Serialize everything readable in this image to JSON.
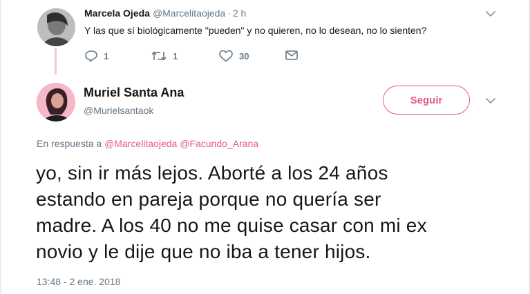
{
  "parent_tweet": {
    "name": "Marcela Ojeda",
    "handle": "@Marcelitaojeda",
    "separator": "·",
    "time": "2 h",
    "text": "Y las que sí biológicamente \"pueden\" y no quieren, no lo desean, no lo sienten?",
    "actions": {
      "reply_count": "1",
      "retweet_count": "1",
      "like_count": "30"
    },
    "icons": [
      "reply-icon",
      "retweet-icon",
      "like-icon",
      "message-icon",
      "chevron-down-icon"
    ]
  },
  "main_tweet": {
    "name": "Muriel Santa Ana",
    "handle": "@Murielsantaok",
    "follow_label": "Seguir",
    "reply_prefix": "En respuesta a",
    "reply_mentions": [
      "@Marcelitaojeda",
      "@Facundo_Arana"
    ],
    "text_lines": [
      "yo, sin ir más lejos. Aborté a los 24 años",
      "estando en pareja porque no quería ser",
      "madre. A los 40 no me quise casar con mi ex",
      "novio y le dije que no iba a tener hijos."
    ],
    "timestamp": "13:48 - 2 ene. 2018"
  },
  "colors": {
    "accent": "#e65b82",
    "secondary_text": "#657786",
    "primary_text": "#14171a",
    "thread_line": "#f3c7d3"
  }
}
